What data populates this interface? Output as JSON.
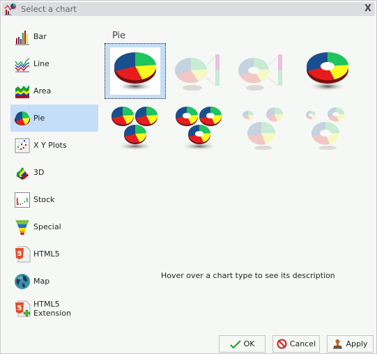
{
  "window": {
    "title": "Select a chart",
    "close_label": "X"
  },
  "sidebar": {
    "items": [
      {
        "label": "Bar",
        "icon": "bar-chart-icon"
      },
      {
        "label": "Line",
        "icon": "line-chart-icon"
      },
      {
        "label": "Area",
        "icon": "area-chart-icon"
      },
      {
        "label": "Pie",
        "icon": "pie-chart-icon",
        "selected": true
      },
      {
        "label": "X Y Plots",
        "icon": "scatter-plot-icon"
      },
      {
        "label": "3D",
        "icon": "3d-chart-icon"
      },
      {
        "label": "Stock",
        "icon": "stock-chart-icon"
      },
      {
        "label": "Special",
        "icon": "funnel-chart-icon"
      },
      {
        "label": "HTML5",
        "icon": "html5-icon"
      },
      {
        "label": "Map",
        "icon": "globe-icon"
      },
      {
        "label": "HTML5 Extension",
        "icon": "html5-extension-icon"
      }
    ]
  },
  "main": {
    "section_title": "Pie",
    "chart_types": [
      {
        "name": "pie",
        "enabled": true,
        "selected": true
      },
      {
        "name": "pie-with-bar",
        "enabled": false
      },
      {
        "name": "ring-with-bar",
        "enabled": false
      },
      {
        "name": "ring",
        "enabled": true
      },
      {
        "name": "multi-pie",
        "enabled": true
      },
      {
        "name": "multi-ring",
        "enabled": true
      },
      {
        "name": "proportional-multi-pie",
        "enabled": false
      },
      {
        "name": "proportional-multi-ring",
        "enabled": false
      }
    ],
    "hint": "Hover over a chart type to see its description"
  },
  "buttons": {
    "ok": "OK",
    "cancel": "Cancel",
    "apply": "Apply"
  },
  "colors": {
    "selection": "#c4defa",
    "pie_blue": "#1a4f8f",
    "pie_green": "#1fc45a",
    "pie_yellow": "#fafa1e",
    "pie_red": "#e81c1c"
  }
}
